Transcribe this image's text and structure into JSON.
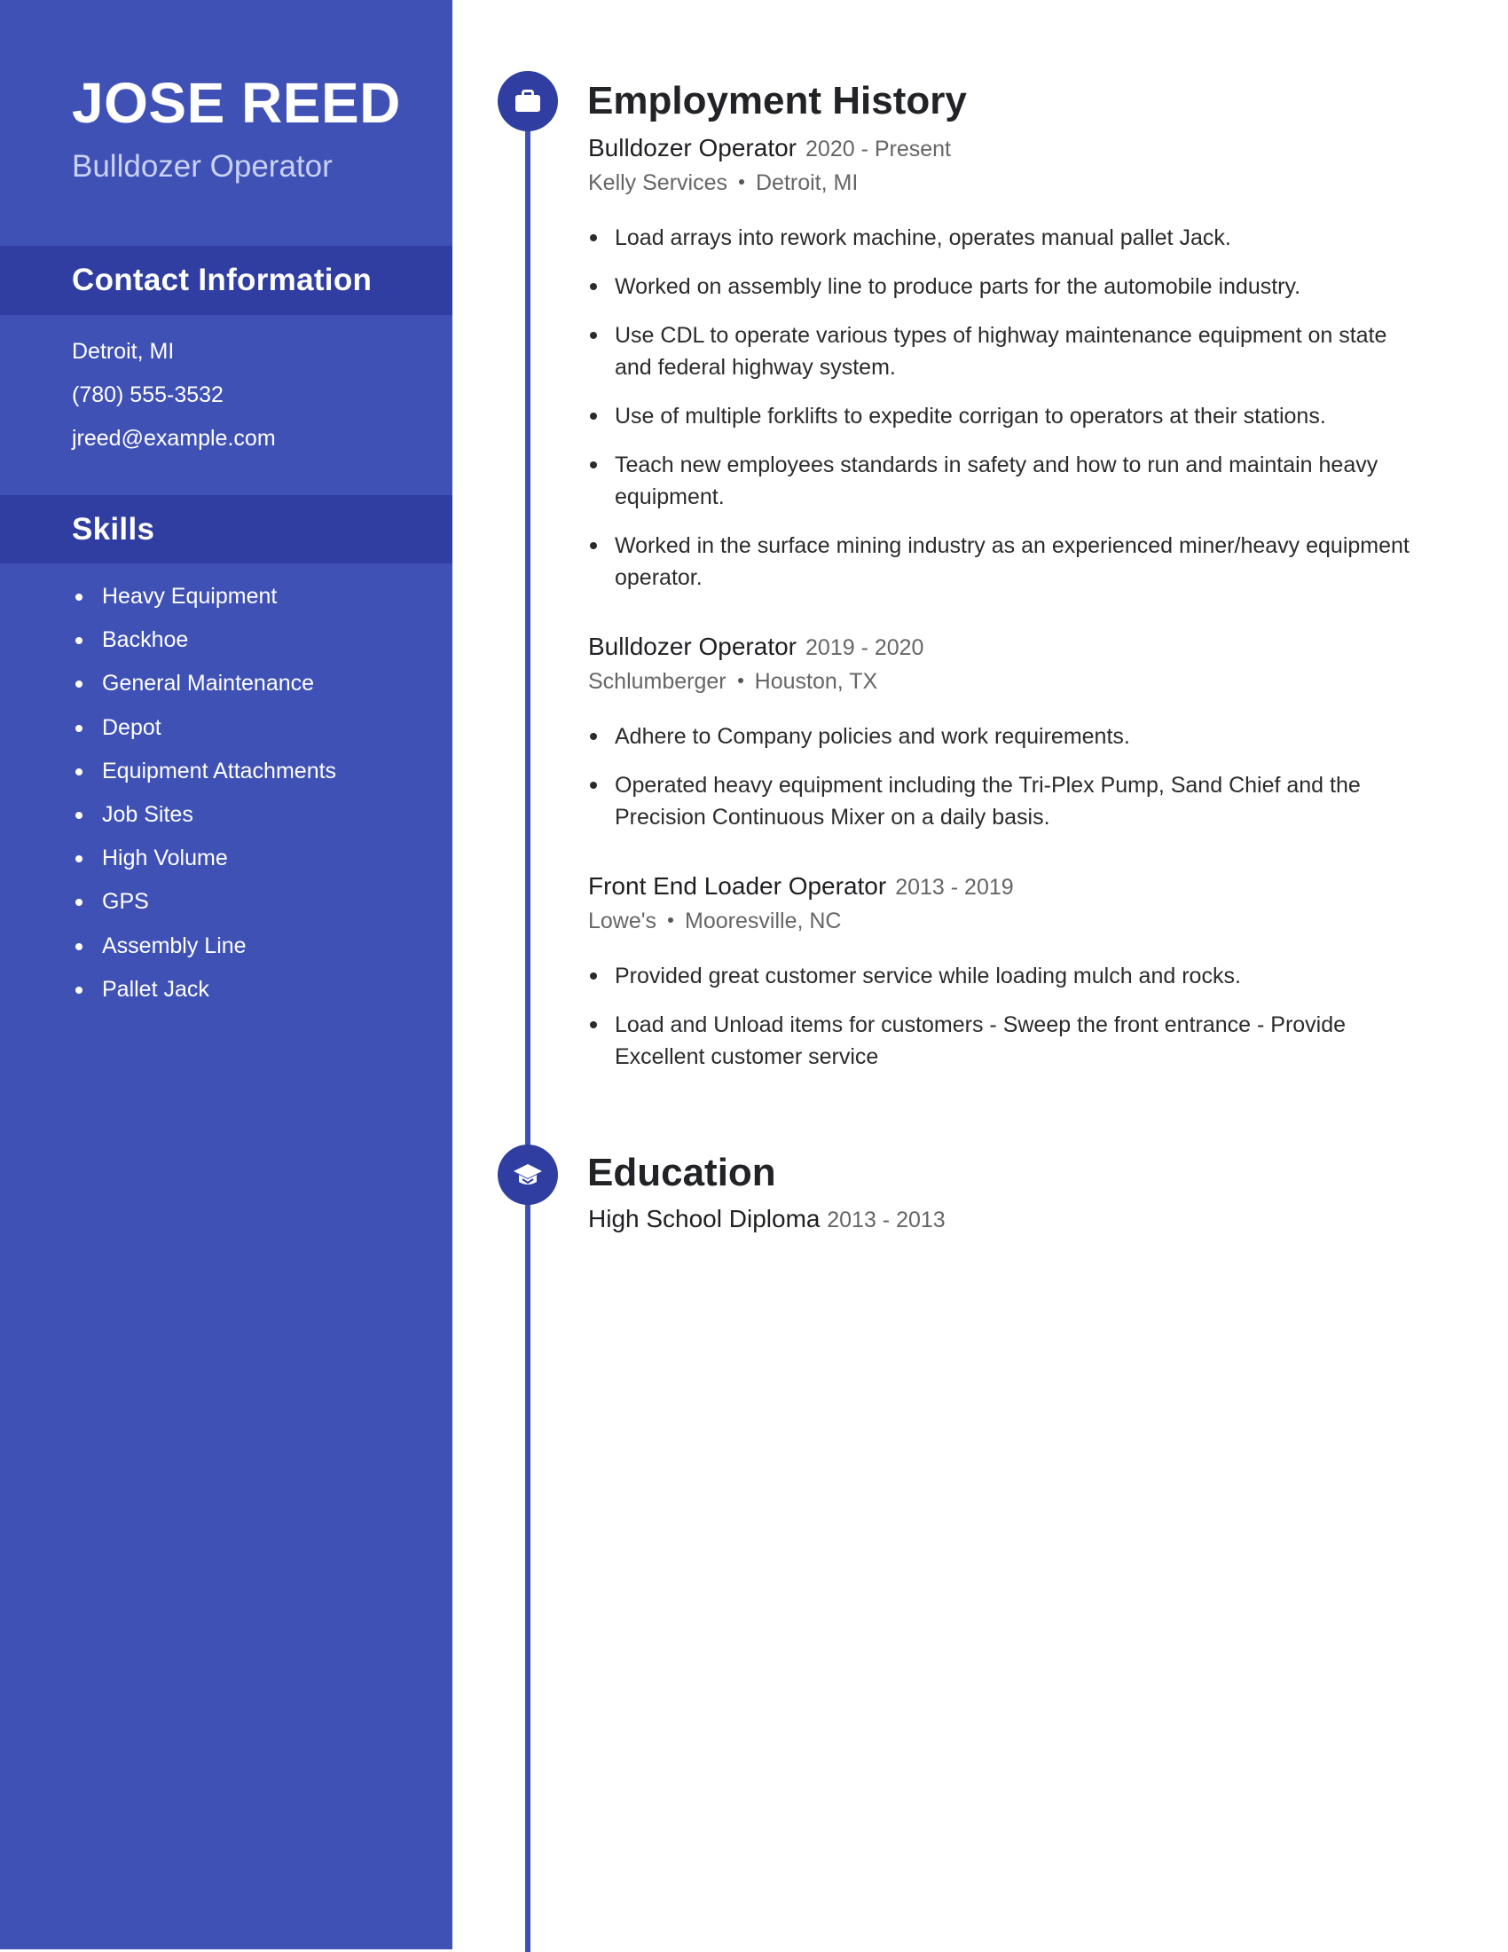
{
  "header": {
    "name": "JOSE REED",
    "title": "Bulldozer Operator"
  },
  "contact": {
    "heading": "Contact Information",
    "items": [
      "Detroit, MI",
      "(780) 555-3532",
      "jreed@example.com"
    ]
  },
  "skills": {
    "heading": "Skills",
    "items": [
      "Heavy Equipment",
      "Backhoe",
      "General Maintenance",
      "Depot",
      "Equipment Attachments",
      "Job Sites",
      "High Volume",
      "GPS",
      "Assembly Line",
      "Pallet Jack"
    ]
  },
  "employment": {
    "heading": "Employment History",
    "icon": "briefcase-icon",
    "jobs": [
      {
        "title": "Bulldozer Operator",
        "dates": "2020 - Present",
        "company": "Kelly Services",
        "location": "Detroit, MI",
        "bullets": [
          "Load arrays into rework machine, operates manual pallet Jack.",
          "Worked on assembly line to produce parts for the automobile industry.",
          "Use CDL to operate various types of highway maintenance equipment on state and federal highway system.",
          "Use of multiple forklifts to expedite corrigan to operators at their stations.",
          "Teach new employees standards in safety and how to run and maintain heavy equipment.",
          "Worked in the surface mining industry as an experienced miner/heavy equipment operator."
        ]
      },
      {
        "title": "Bulldozer Operator",
        "dates": "2019 - 2020",
        "company": "Schlumberger",
        "location": "Houston, TX",
        "bullets": [
          "Adhere to Company policies and work requirements.",
          "Operated heavy equipment including the Tri-Plex Pump, Sand Chief and the Precision Continuous Mixer on a daily basis."
        ]
      },
      {
        "title": "Front End Loader Operator",
        "dates": "2013 - 2019",
        "company": "Lowe's",
        "location": "Mooresville, NC",
        "bullets": [
          "Provided great customer service while loading mulch and rocks.",
          "Load and Unload items for customers - Sweep the front entrance - Provide Excellent customer service"
        ]
      }
    ]
  },
  "education": {
    "heading": "Education",
    "icon": "graduation-cap-icon",
    "degree": "High School Diploma",
    "dates": "2013 - 2013"
  },
  "colors": {
    "sidebar": "#3f51b5",
    "sidebar_band": "#2f3ea0",
    "accent": "#3f51b5",
    "text": "#222326",
    "muted": "#666666"
  }
}
